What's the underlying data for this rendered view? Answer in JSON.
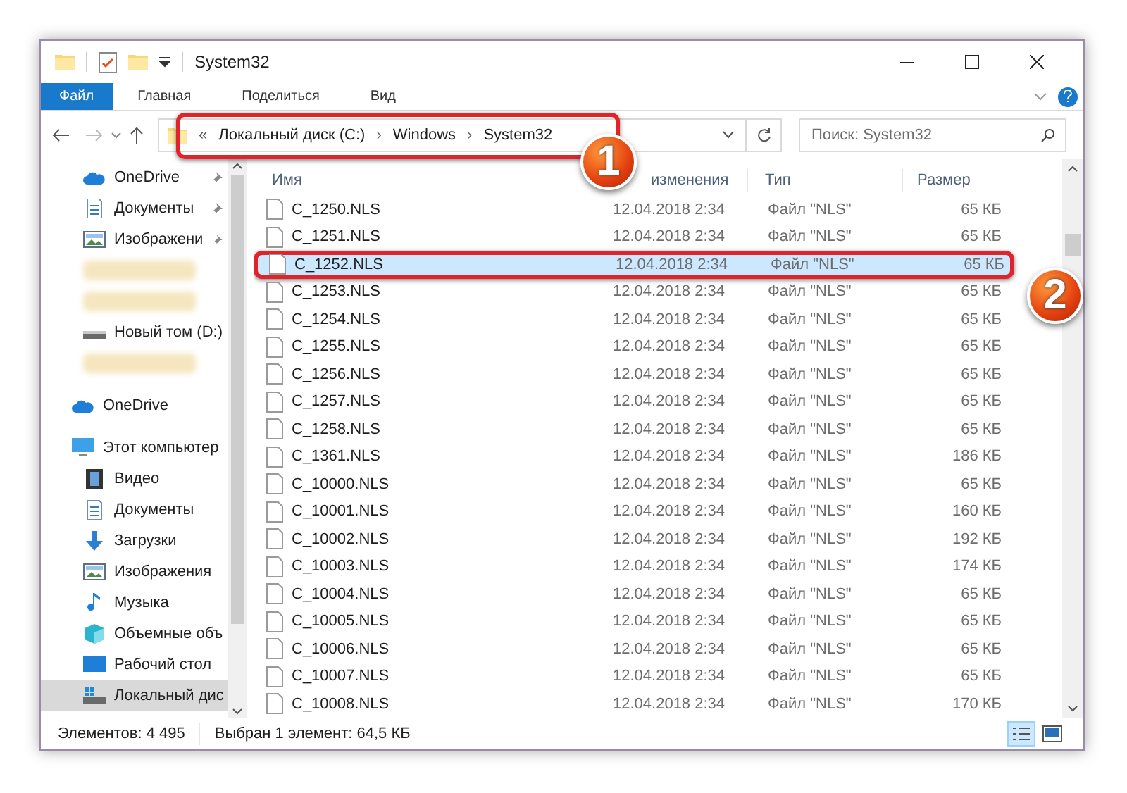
{
  "window": {
    "title": "System32"
  },
  "ribbon_tabs": [
    {
      "label": "Файл",
      "kind": "file"
    },
    {
      "label": "Главная",
      "kind": "tab"
    },
    {
      "label": "Поделиться",
      "kind": "tab"
    },
    {
      "label": "Вид",
      "kind": "tab"
    }
  ],
  "address": {
    "overflow": "«",
    "parts": [
      "Локальный диск (C:)",
      "Windows",
      "System32"
    ],
    "separator": "›"
  },
  "search": {
    "placeholder": "Поиск: System32"
  },
  "sidebar": {
    "items": [
      {
        "label": "OneDrive",
        "kind": "cloud",
        "pinned": true,
        "selected": false
      },
      {
        "label": "Документы",
        "kind": "docs",
        "pinned": true,
        "selected": false
      },
      {
        "label": "Изображени",
        "kind": "pictures",
        "pinned": true,
        "selected": false
      },
      {
        "kind": "blurred",
        "selected": false
      },
      {
        "kind": "blurred",
        "selected": false
      },
      {
        "label": "Новый том (D:)",
        "kind": "drive",
        "selected": false
      },
      {
        "kind": "blurred",
        "selected": false
      },
      {
        "label": "OneDrive",
        "kind": "cloud",
        "selected": false,
        "group": true
      },
      {
        "label": "Этот компьютер",
        "kind": "pc",
        "selected": false,
        "group": true
      },
      {
        "label": "Видео",
        "kind": "video",
        "selected": false
      },
      {
        "label": "Документы",
        "kind": "docs",
        "selected": false
      },
      {
        "label": "Загрузки",
        "kind": "download",
        "selected": false
      },
      {
        "label": "Изображения",
        "kind": "pictures",
        "selected": false
      },
      {
        "label": "Музыка",
        "kind": "music",
        "selected": false
      },
      {
        "label": "Объемные объ",
        "kind": "cube",
        "selected": false
      },
      {
        "label": "Рабочий стол",
        "kind": "desktop",
        "selected": false
      },
      {
        "label": "Локальный дис",
        "kind": "windrive",
        "selected": true
      }
    ]
  },
  "table": {
    "columns": [
      "Имя",
      "изменения",
      "Тип",
      "Размер"
    ],
    "rows": [
      {
        "name": "C_1250.NLS",
        "date": "12.04.2018 2:34",
        "type": "Файл \"NLS\"",
        "size": "65 КБ",
        "selected": false
      },
      {
        "name": "C_1251.NLS",
        "date": "12.04.2018 2:34",
        "type": "Файл \"NLS\"",
        "size": "65 КБ",
        "selected": false
      },
      {
        "name": "C_1252.NLS",
        "date": "12.04.2018 2:34",
        "type": "Файл \"NLS\"",
        "size": "65 КБ",
        "selected": true
      },
      {
        "name": "C_1253.NLS",
        "date": "12.04.2018 2:34",
        "type": "Файл \"NLS\"",
        "size": "65 КБ",
        "selected": false
      },
      {
        "name": "C_1254.NLS",
        "date": "12.04.2018 2:34",
        "type": "Файл \"NLS\"",
        "size": "65 КБ",
        "selected": false
      },
      {
        "name": "C_1255.NLS",
        "date": "12.04.2018 2:34",
        "type": "Файл \"NLS\"",
        "size": "65 КБ",
        "selected": false
      },
      {
        "name": "C_1256.NLS",
        "date": "12.04.2018 2:34",
        "type": "Файл \"NLS\"",
        "size": "65 КБ",
        "selected": false
      },
      {
        "name": "C_1257.NLS",
        "date": "12.04.2018 2:34",
        "type": "Файл \"NLS\"",
        "size": "65 КБ",
        "selected": false
      },
      {
        "name": "C_1258.NLS",
        "date": "12.04.2018 2:34",
        "type": "Файл \"NLS\"",
        "size": "65 КБ",
        "selected": false
      },
      {
        "name": "C_1361.NLS",
        "date": "12.04.2018 2:34",
        "type": "Файл \"NLS\"",
        "size": "186 КБ",
        "selected": false
      },
      {
        "name": "C_10000.NLS",
        "date": "12.04.2018 2:34",
        "type": "Файл \"NLS\"",
        "size": "65 КБ",
        "selected": false
      },
      {
        "name": "C_10001.NLS",
        "date": "12.04.2018 2:34",
        "type": "Файл \"NLS\"",
        "size": "160 КБ",
        "selected": false
      },
      {
        "name": "C_10002.NLS",
        "date": "12.04.2018 2:34",
        "type": "Файл \"NLS\"",
        "size": "192 КБ",
        "selected": false
      },
      {
        "name": "C_10003.NLS",
        "date": "12.04.2018 2:34",
        "type": "Файл \"NLS\"",
        "size": "174 КБ",
        "selected": false
      },
      {
        "name": "C_10004.NLS",
        "date": "12.04.2018 2:34",
        "type": "Файл \"NLS\"",
        "size": "65 КБ",
        "selected": false
      },
      {
        "name": "C_10005.NLS",
        "date": "12.04.2018 2:34",
        "type": "Файл \"NLS\"",
        "size": "65 КБ",
        "selected": false
      },
      {
        "name": "C_10006.NLS",
        "date": "12.04.2018 2:34",
        "type": "Файл \"NLS\"",
        "size": "65 КБ",
        "selected": false
      },
      {
        "name": "C_10007.NLS",
        "date": "12.04.2018 2:34",
        "type": "Файл \"NLS\"",
        "size": "65 КБ",
        "selected": false
      },
      {
        "name": "C_10008.NLS",
        "date": "12.04.2018 2:34",
        "type": "Файл \"NLS\"",
        "size": "170 КБ",
        "selected": false
      }
    ]
  },
  "status_bar": {
    "count": "Элементов: 4 495",
    "selection": "Выбран 1 элемент: 64,5 КБ",
    "views": [
      {
        "kind": "details",
        "selected": true
      },
      {
        "kind": "tiles",
        "selected": false
      }
    ]
  },
  "callouts": [
    {
      "number": "1"
    },
    {
      "number": "2"
    }
  ]
}
